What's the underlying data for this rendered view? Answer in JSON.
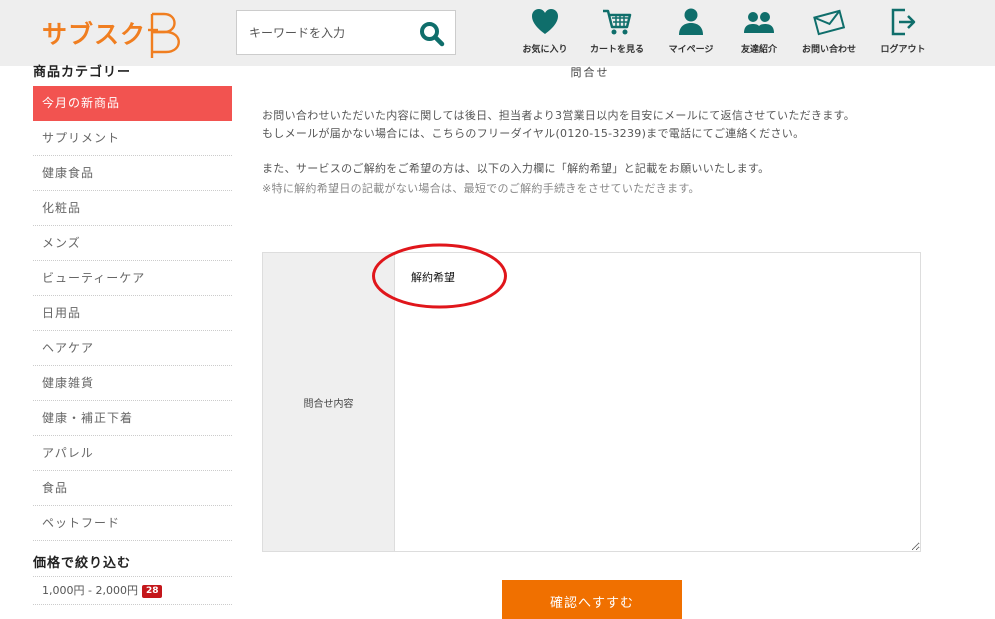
{
  "header": {
    "logo_text": "サブスク",
    "logo_letter": "B",
    "search": {
      "placeholder": "キーワードを入力"
    },
    "nav": [
      {
        "label": "お気に入り",
        "icon": "heart-icon"
      },
      {
        "label": "カートを見る",
        "icon": "cart-icon"
      },
      {
        "label": "マイページ",
        "icon": "user-icon"
      },
      {
        "label": "友達紹介",
        "icon": "users-icon"
      },
      {
        "label": "お問い合わせ",
        "icon": "mail-icon"
      },
      {
        "label": "ログアウト",
        "icon": "logout-icon"
      }
    ]
  },
  "sidebar": {
    "category_title": "商品カテゴリー",
    "categories": [
      "今月の新商品",
      "サプリメント",
      "健康食品",
      "化粧品",
      "メンズ",
      "ビューティーケア",
      "日用品",
      "ヘアケア",
      "健康雑貨",
      "健康・補正下着",
      "アパレル",
      "食品",
      "ペットフード"
    ],
    "price_title": "価格で絞り込む",
    "price_filters": [
      {
        "label": "1,000円 - 2,000円",
        "count": "28"
      }
    ]
  },
  "main": {
    "page_title": "問合せ",
    "notice": {
      "line1": "お問い合わせいただいた内容に関しては後日、担当者より3営業日以内を目安にメールにて返信させていただきます。",
      "line2": "もしメールが届かない場合には、こちらのフリーダイヤル(0120-15-3239)まで電話にてご連絡ください。",
      "line3": "また、サービスのご解約をご希望の方は、以下の入力欄に「解約希望」と記載をお願いいたします。",
      "line4": "※特に解約希望日の記載がない場合は、最短でのご解約手続きをさせていただきます。"
    },
    "form": {
      "label": "問合せ内容",
      "value": "解約希望"
    },
    "submit_label": "確認へすすむ"
  },
  "colors": {
    "brand_orange": "#f07e20",
    "icon_teal": "#0f6e6b",
    "active_category": "#f25350",
    "submit_button": "#f07000",
    "badge": "#c4171b",
    "highlight_ring": "#e0161b"
  }
}
